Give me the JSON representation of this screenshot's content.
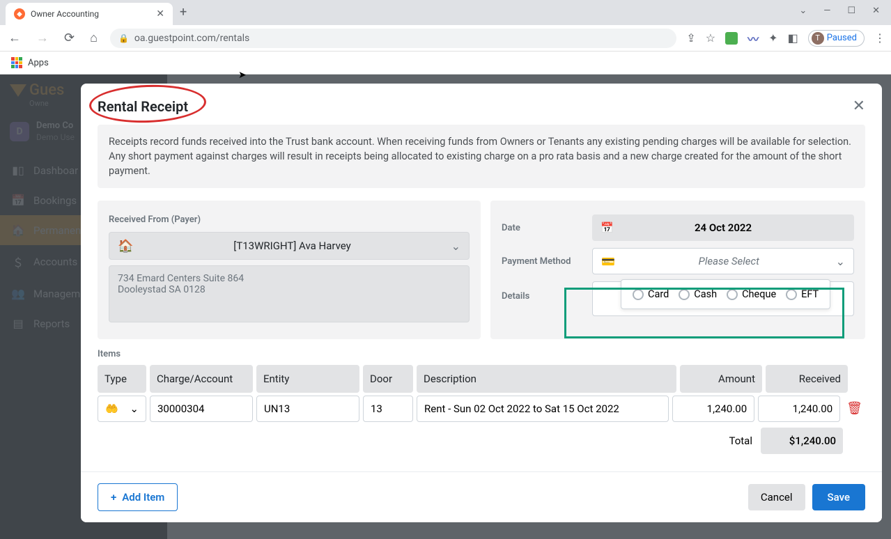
{
  "browser": {
    "tab_title": "Owner Accounting",
    "url": "oa.guestpoint.com/rentals",
    "apps_label": "Apps",
    "paused_label": "Paused",
    "profile_initial": "T"
  },
  "sidebar": {
    "logo_text": "Gues",
    "logo_sub": "Owne",
    "user_initial": "D",
    "user_company": "Demo Co",
    "user_name": "Demo Use",
    "items": [
      {
        "label": "Dashboar"
      },
      {
        "label": "Bookings"
      },
      {
        "label": "Permanen"
      },
      {
        "label": "Accounts"
      },
      {
        "label": "Managem"
      },
      {
        "label": "Reports"
      }
    ]
  },
  "modal": {
    "title": "Rental Receipt",
    "info": "Receipts record funds received into the Trust bank account. When receiving funds from Owners or Tenants any existing pending charges will be available for selection. Any short payment against charges will result in receipts being allocated to existing charge on a pro rata basis and a new charge created for the amount of the short payment.",
    "payer_label": "Received From (Payer)",
    "payer_value": "[T13WRIGHT] Ava Harvey",
    "payer_address": "734 Emard Centers Suite 864\nDooleystad SA 0128",
    "date_label": "Date",
    "date_value": "24 Oct 2022",
    "method_label": "Payment Method",
    "method_placeholder": "Please Select",
    "details_label": "Details",
    "options": {
      "card": "Card",
      "cash": "Cash",
      "cheque": "Cheque",
      "eft": "EFT"
    },
    "items_label": "Items",
    "headers": {
      "type": "Type",
      "charge": "Charge/Account",
      "entity": "Entity",
      "door": "Door",
      "desc": "Description",
      "amount": "Amount",
      "received": "Received"
    },
    "row": {
      "charge": "30000304",
      "entity": "UN13",
      "door": "13",
      "desc": "Rent - Sun 02 Oct 2022 to Sat 15 Oct 2022",
      "amount": "1,240.00",
      "received": "1,240.00"
    },
    "total_label": "Total",
    "total_value": "$1,240.00",
    "add_item": "Add Item",
    "cancel": "Cancel",
    "save": "Save"
  }
}
